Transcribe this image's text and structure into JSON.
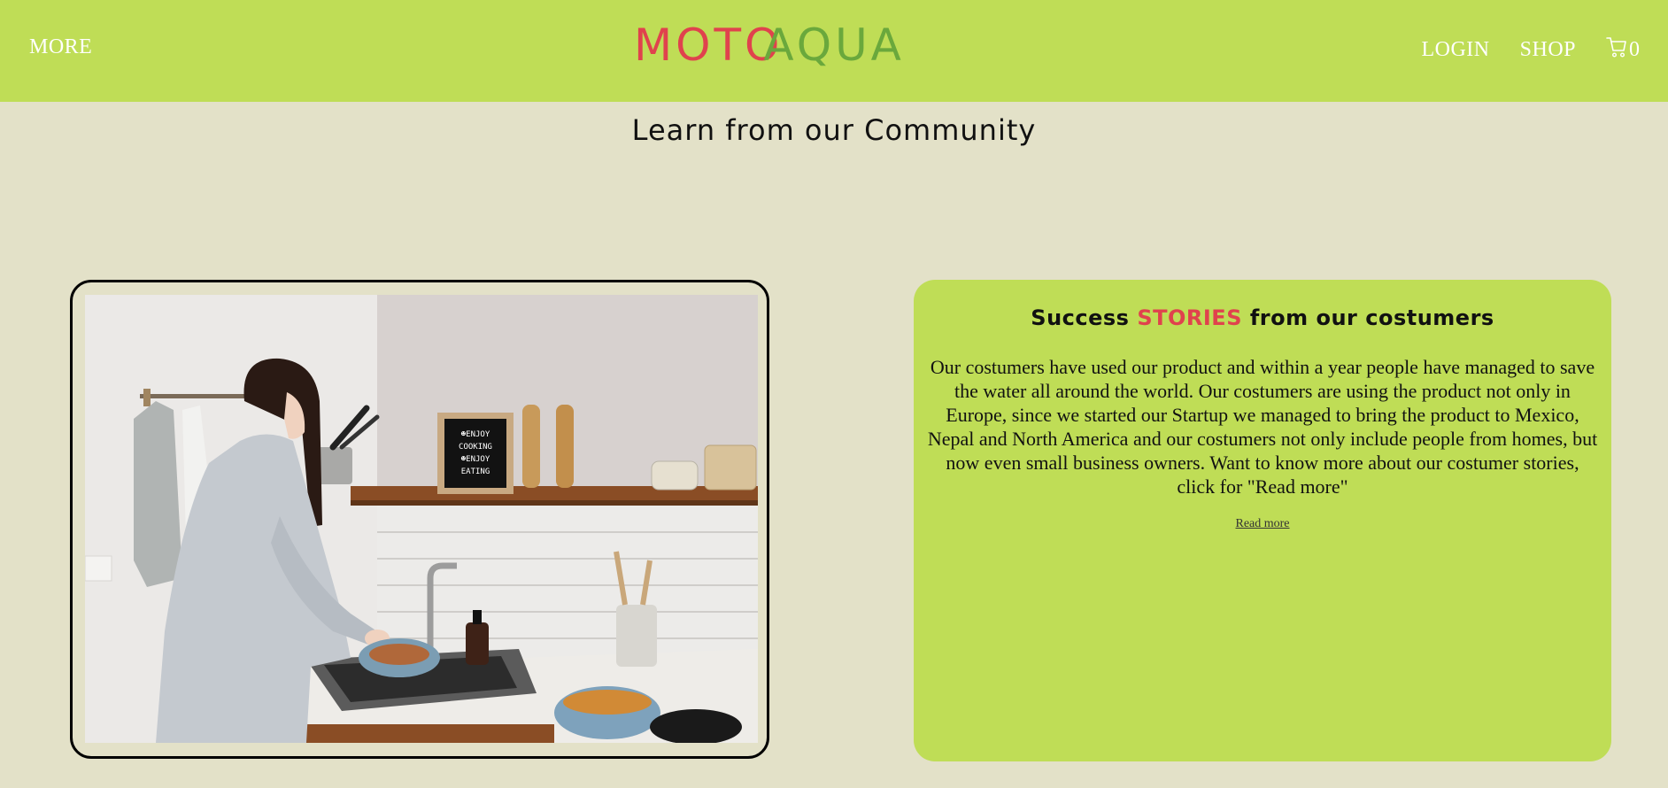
{
  "header": {
    "more_label": "MORE",
    "logo": {
      "part1": "MOTO",
      "part2": "AQUA"
    },
    "login_label": "LOGIN",
    "shop_label": "SHOP",
    "cart_icon": "cart-icon",
    "cart_count": "0"
  },
  "main": {
    "title": "Learn from our Community"
  },
  "story": {
    "title_prefix": "Success ",
    "title_accent": "STORIES",
    "title_suffix": " from our costumers",
    "body": "Our costumers have used our product and within a year people have managed to save the water all around the world. Our costumers are using the product not only in Europe, since we started our Startup we managed to bring the product to Mexico, Nepal and North America and our costumers not only include people from homes, but now even small business owners. Want to know more about our costumer stories, click for \"Read more\"",
    "read_more_label": "Read more",
    "photo_sign": {
      "line1": "☻ENJOY",
      "line2": "COOKING",
      "line3": "☻ENJOY",
      "line4": "EATING"
    }
  },
  "colors": {
    "header_bg": "#bfdd56",
    "page_bg": "#e3e1c8",
    "logo_red": "#e0424d",
    "logo_green": "#6aa83c",
    "accent": "#e0424d"
  }
}
